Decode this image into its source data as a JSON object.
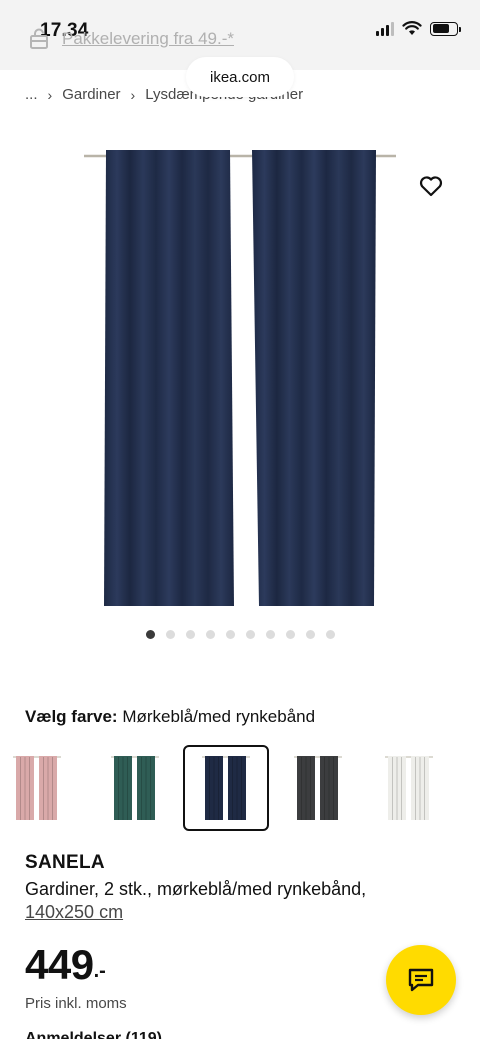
{
  "status_bar": {
    "time": "17.34"
  },
  "browser": {
    "url": "ikea.com"
  },
  "promo": {
    "text": "Pakkelevering fra 49.-*",
    "icon": "lock-box-icon"
  },
  "breadcrumb": {
    "items": [
      "...",
      "Gardiner",
      "Lysdæmpende gardiner"
    ]
  },
  "gallery": {
    "image_count": 10,
    "active_index": 0
  },
  "color_picker": {
    "label": "Vælg farve:",
    "selected": "Mørkeblå/med rynkebånd",
    "swatches": [
      {
        "name": "pink",
        "color": "#d9a9a9"
      },
      {
        "name": "dark-turquoise",
        "color": "#2f5d55"
      },
      {
        "name": "dark-blue",
        "color": "#1f2a44",
        "selected": true
      },
      {
        "name": "dark-grey",
        "color": "#3c3d3f"
      },
      {
        "name": "off-white",
        "color": "#eeeeea"
      }
    ]
  },
  "product": {
    "name": "SANELA",
    "description": "Gardiner, 2 stk., mørkeblå/med rynkebånd,",
    "size": "140x250 cm",
    "price": "449",
    "price_suffix": ".-",
    "price_note": "Pris inkl. moms"
  },
  "colors": {
    "accent_yellow": "#ffdb00",
    "curtain": "#243150"
  },
  "partial_text": "Anmeldelser (119)"
}
